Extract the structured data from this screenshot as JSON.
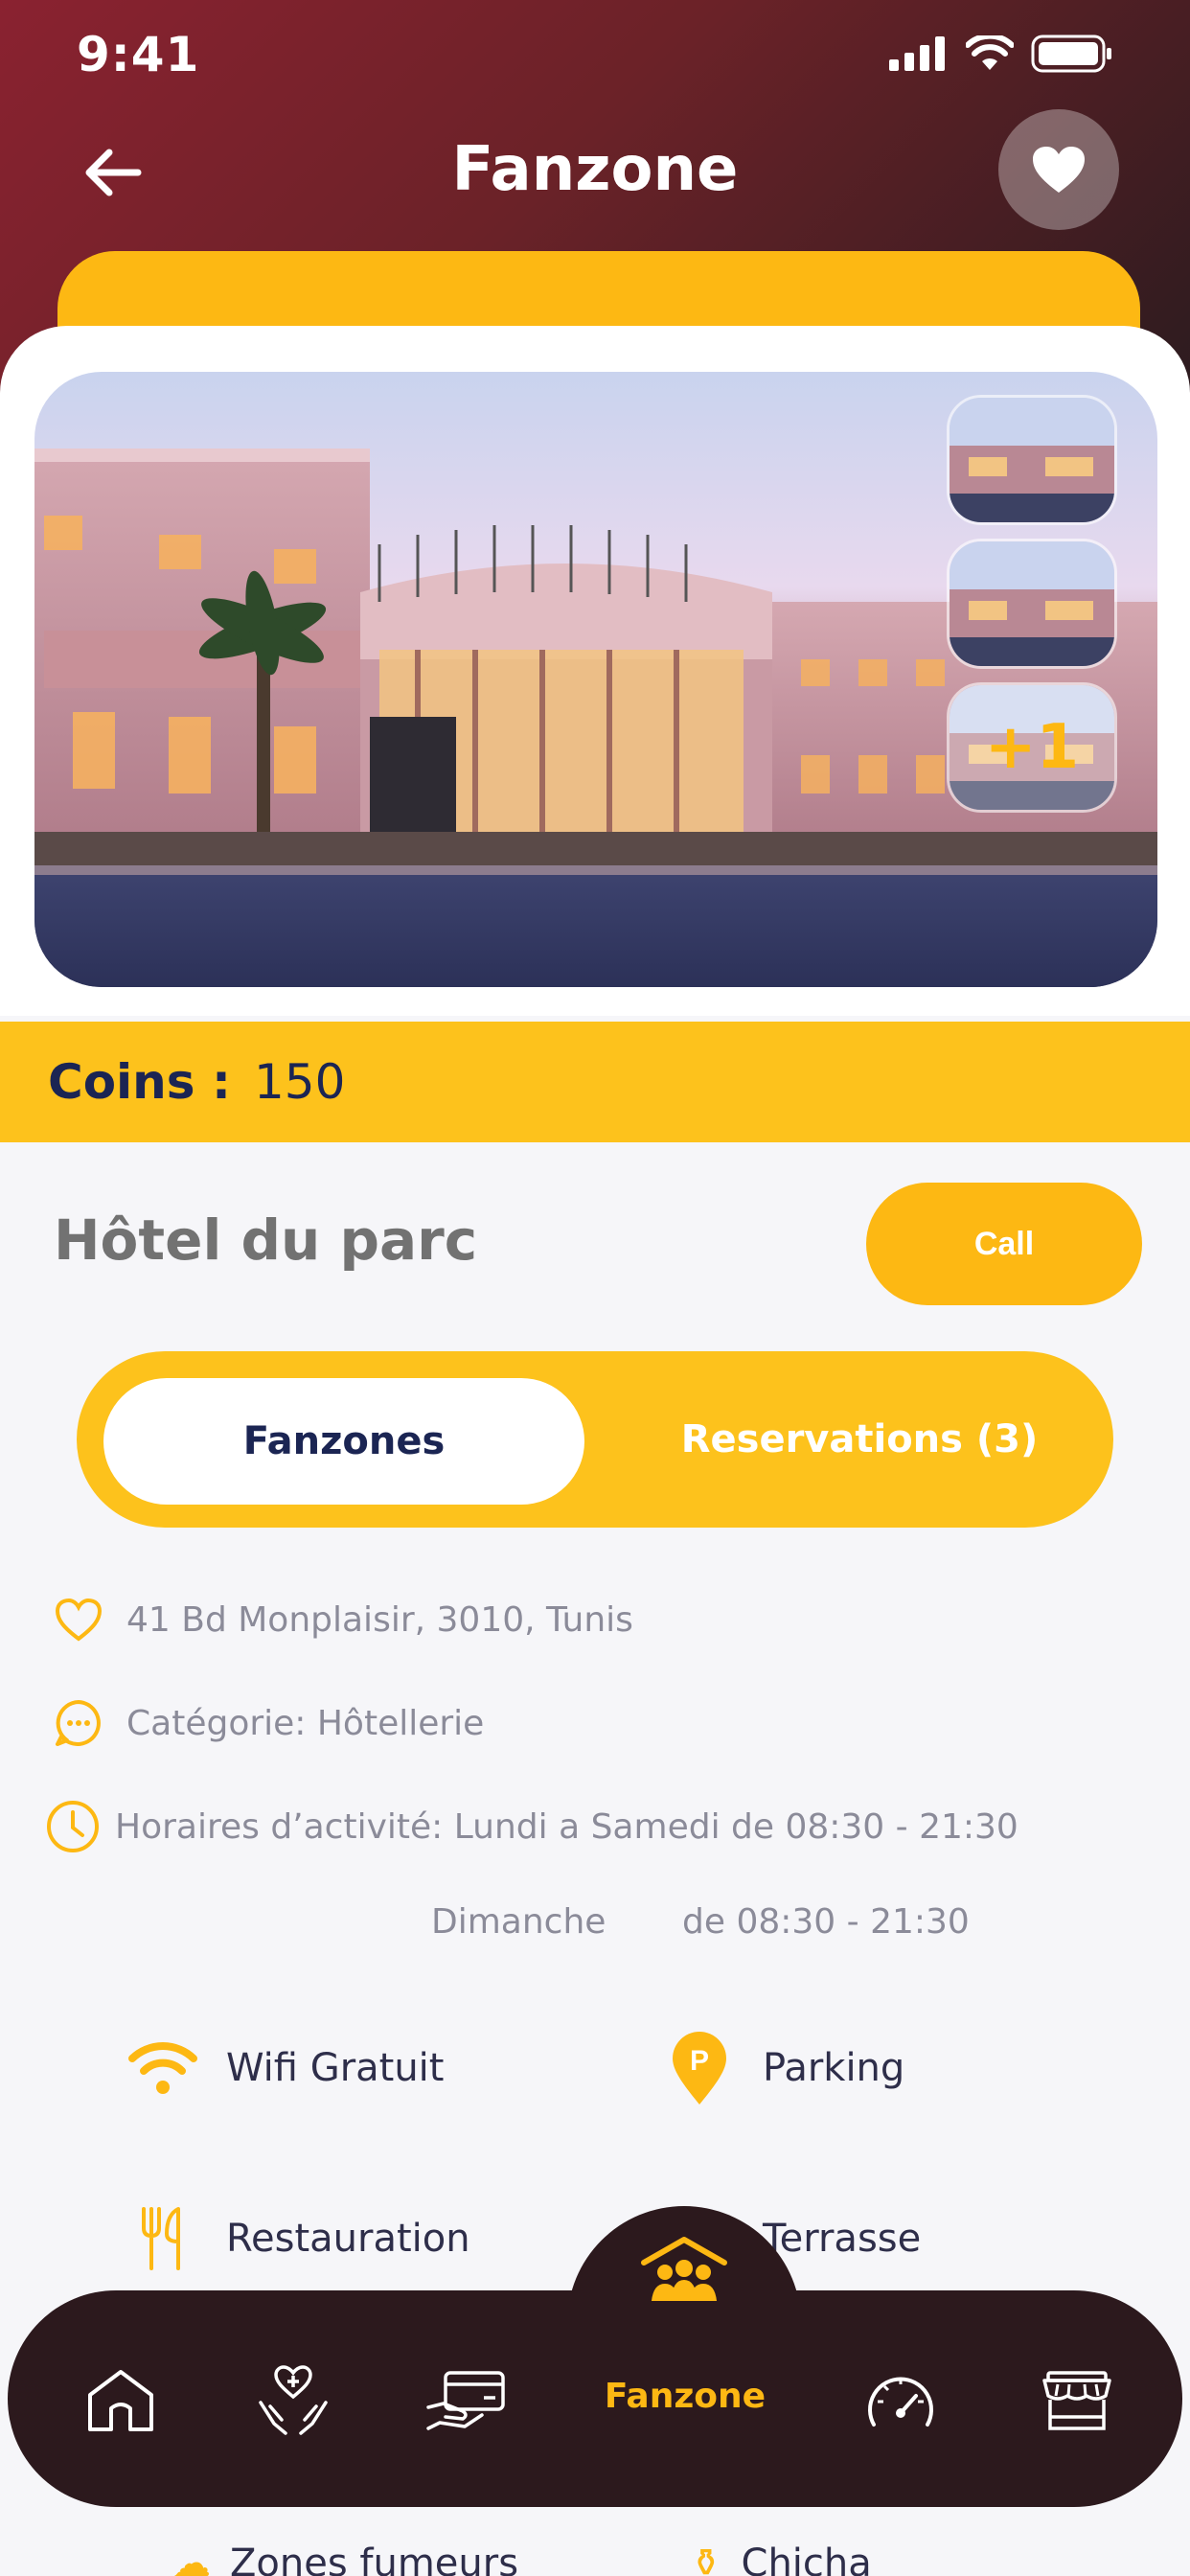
{
  "status_bar": {
    "time": "9:41"
  },
  "header": {
    "title": "Fanzone"
  },
  "coins": {
    "label": "Coins :",
    "value": "150"
  },
  "hotel": {
    "name": "Hôtel du parc",
    "call_label": "Call"
  },
  "tabs": [
    {
      "label": "Fanzones",
      "active": true
    },
    {
      "label": "Reservations (3)",
      "active": false
    }
  ],
  "gallery": {
    "more_label": "+1"
  },
  "details": {
    "address": "41 Bd Monplaisir, 3010, Tunis",
    "category": "Catégorie: Hôtellerie",
    "hours": "Horaires d’activité: Lundi a Samedi de 08:30 - 21:30",
    "sunday_day": "Dimanche",
    "sunday_hours": "de 08:30 - 21:30"
  },
  "amenities": [
    "Wifi Gratuit",
    "Parking",
    "Restauration",
    "Terrasse",
    "Zones fumeurs",
    "Chicha"
  ],
  "bottom_nav": {
    "active_label": "Fanzone",
    "items": [
      "home-icon",
      "care-hands-icon",
      "payment-card-icon",
      "fanzone-icon",
      "speedometer-icon",
      "store-icon"
    ]
  },
  "colors": {
    "accent": "#FDB813",
    "coins_bar": "#FDC21C",
    "header_gradient_start": "#8A2230",
    "header_gradient_end": "#2C1B1F",
    "nav_bg": "#2C191D",
    "navy": "#1B2553"
  }
}
